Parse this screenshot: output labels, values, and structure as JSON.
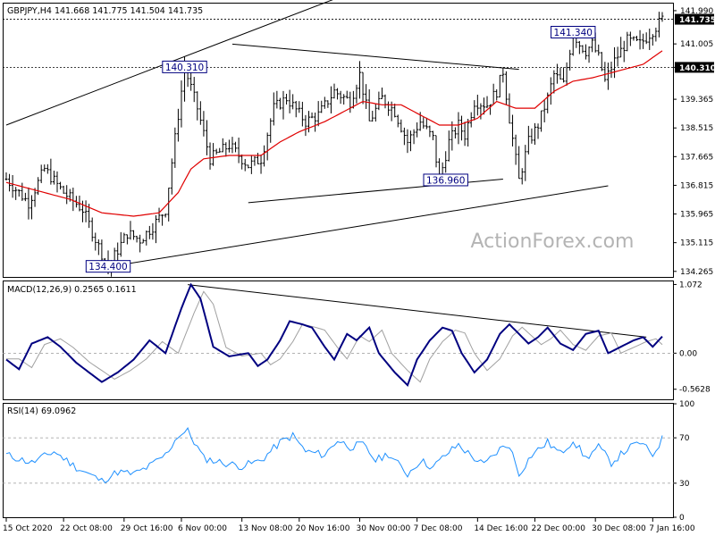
{
  "colors": {
    "bar": "#000000",
    "ma": "#e00000",
    "macd": "#000080",
    "signal": "#a0a0a0",
    "rsi": "#1e90ff",
    "watermark": "#b4b4b4",
    "label_box": "#000080",
    "price_tag": "#000000"
  },
  "chart_data": [
    {
      "type": "line",
      "panel": "price",
      "title": "GBPJPY,H4  141.668 141.775 141.504 141.735",
      "watermark": "ActionForex.com",
      "ylim": [
        134.1,
        142.2
      ],
      "y_ticks": [
        "141.990",
        "141.005",
        "140.310",
        "139.365",
        "138.515",
        "137.665",
        "136.815",
        "135.965",
        "135.115",
        "134.265"
      ],
      "y_tick_values": [
        141.99,
        141.005,
        140.31,
        139.365,
        138.515,
        137.665,
        136.815,
        135.965,
        135.115,
        134.265
      ],
      "current_price": "141.735",
      "current_price_value": 141.735,
      "level_price": "140.310",
      "level_price_value": 140.31,
      "annotations": [
        {
          "text": "140.310",
          "i": 56,
          "y": 140.31
        },
        {
          "text": "134.400",
          "i": 32,
          "y": 134.4
        },
        {
          "text": "136.960",
          "i": 138,
          "y": 136.96
        },
        {
          "text": "141.340",
          "i": 178,
          "y": 141.34
        }
      ],
      "lines": [
        {
          "name": "upper-channel-line",
          "i1": 0,
          "y1": 138.6,
          "i2": 109,
          "y2": 142.55
        },
        {
          "name": "lower-channel-line",
          "i1": 32,
          "y1": 134.4,
          "i2": 189,
          "y2": 136.8
        },
        {
          "name": "upper-triangle-line",
          "i1": 71,
          "y1": 141.0,
          "i2": 161,
          "y2": 140.25
        },
        {
          "name": "lower-triangle-line",
          "i1": 76,
          "y1": 136.3,
          "i2": 156,
          "y2": 137.0
        }
      ],
      "keypoints": [
        [
          0,
          137.0
        ],
        [
          7,
          136.3
        ],
        [
          12,
          137.3
        ],
        [
          18,
          136.6
        ],
        [
          24,
          136.1
        ],
        [
          29,
          135.0
        ],
        [
          32,
          134.4
        ],
        [
          38,
          135.4
        ],
        [
          42,
          135.2
        ],
        [
          46,
          135.6
        ],
        [
          50,
          136.1
        ],
        [
          54,
          138.9
        ],
        [
          56,
          140.31
        ],
        [
          60,
          139.1
        ],
        [
          64,
          137.6
        ],
        [
          70,
          138.0
        ],
        [
          76,
          137.4
        ],
        [
          80,
          137.6
        ],
        [
          84,
          139.1
        ],
        [
          88,
          139.4
        ],
        [
          94,
          138.7
        ],
        [
          98,
          138.9
        ],
        [
          103,
          139.6
        ],
        [
          108,
          139.3
        ],
        [
          111,
          140.1
        ],
        [
          114,
          138.7
        ],
        [
          118,
          139.4
        ],
        [
          122,
          139.0
        ],
        [
          126,
          138.1
        ],
        [
          130,
          138.7
        ],
        [
          134,
          138.2
        ],
        [
          136,
          136.96
        ],
        [
          139,
          138.1
        ],
        [
          142,
          138.6
        ],
        [
          144,
          138.3
        ],
        [
          147,
          139.3
        ],
        [
          151,
          139.2
        ],
        [
          154,
          139.6
        ],
        [
          156,
          140.2
        ],
        [
          158,
          138.8
        ],
        [
          161,
          136.96
        ],
        [
          164,
          138.1
        ],
        [
          167,
          138.6
        ],
        [
          170,
          139.4
        ],
        [
          172,
          140.1
        ],
        [
          175,
          139.8
        ],
        [
          178,
          141.34
        ],
        [
          180,
          141.0
        ],
        [
          182,
          140.8
        ],
        [
          184,
          141.0
        ],
        [
          186,
          140.6
        ],
        [
          188,
          139.9
        ],
        [
          191,
          140.5
        ],
        [
          195,
          141.1
        ],
        [
          199,
          141.0
        ],
        [
          203,
          141.4
        ],
        [
          206,
          141.735
        ]
      ],
      "ma_keypoints": [
        [
          0,
          136.9
        ],
        [
          12,
          136.6
        ],
        [
          20,
          136.4
        ],
        [
          30,
          136.0
        ],
        [
          40,
          135.9
        ],
        [
          48,
          136.0
        ],
        [
          54,
          136.6
        ],
        [
          58,
          137.3
        ],
        [
          62,
          137.6
        ],
        [
          70,
          137.7
        ],
        [
          80,
          137.7
        ],
        [
          86,
          138.1
        ],
        [
          92,
          138.4
        ],
        [
          100,
          138.7
        ],
        [
          106,
          139.0
        ],
        [
          112,
          139.3
        ],
        [
          118,
          139.2
        ],
        [
          124,
          139.2
        ],
        [
          130,
          138.9
        ],
        [
          136,
          138.6
        ],
        [
          142,
          138.6
        ],
        [
          148,
          138.8
        ],
        [
          154,
          139.3
        ],
        [
          160,
          139.1
        ],
        [
          166,
          139.1
        ],
        [
          172,
          139.6
        ],
        [
          178,
          139.9
        ],
        [
          184,
          140.0
        ],
        [
          192,
          140.2
        ],
        [
          200,
          140.4
        ],
        [
          206,
          140.8
        ]
      ],
      "n_bars": 207,
      "seed": 7
    },
    {
      "type": "line",
      "panel": "macd",
      "title": "MACD(12,26,9) 0.2565 0.1611",
      "ylim": [
        -0.72,
        1.12
      ],
      "y_ticks": [
        "1.072",
        "0.00",
        "-0.5628"
      ],
      "y_tick_values": [
        1.072,
        0.0,
        -0.5628
      ],
      "trendline": {
        "i1": 57,
        "y1": 1.07,
        "i2": 201,
        "y2": 0.25
      },
      "keypoints": [
        [
          0,
          -0.1
        ],
        [
          4,
          -0.25
        ],
        [
          8,
          0.15
        ],
        [
          13,
          0.25
        ],
        [
          17,
          0.1
        ],
        [
          22,
          -0.15
        ],
        [
          30,
          -0.45
        ],
        [
          35,
          -0.3
        ],
        [
          40,
          -0.1
        ],
        [
          45,
          0.2
        ],
        [
          50,
          0.0
        ],
        [
          55,
          0.7
        ],
        [
          58,
          1.07
        ],
        [
          61,
          0.85
        ],
        [
          65,
          0.1
        ],
        [
          70,
          -0.05
        ],
        [
          76,
          0.0
        ],
        [
          79,
          -0.2
        ],
        [
          82,
          -0.1
        ],
        [
          86,
          0.2
        ],
        [
          89,
          0.5
        ],
        [
          93,
          0.45
        ],
        [
          96,
          0.4
        ],
        [
          100,
          0.1
        ],
        [
          103,
          -0.1
        ],
        [
          107,
          0.3
        ],
        [
          110,
          0.2
        ],
        [
          114,
          0.4
        ],
        [
          117,
          0.0
        ],
        [
          122,
          -0.3
        ],
        [
          126,
          -0.5
        ],
        [
          129,
          -0.1
        ],
        [
          133,
          0.2
        ],
        [
          137,
          0.4
        ],
        [
          140,
          0.35
        ],
        [
          143,
          0.0
        ],
        [
          147,
          -0.3
        ],
        [
          151,
          -0.1
        ],
        [
          155,
          0.3
        ],
        [
          158,
          0.45
        ],
        [
          161,
          0.3
        ],
        [
          164,
          0.15
        ],
        [
          167,
          0.25
        ],
        [
          170,
          0.4
        ],
        [
          174,
          0.15
        ],
        [
          178,
          0.05
        ],
        [
          182,
          0.3
        ],
        [
          186,
          0.35
        ],
        [
          189,
          0.0
        ],
        [
          193,
          0.1
        ],
        [
          197,
          0.2
        ],
        [
          200,
          0.25
        ],
        [
          203,
          0.1
        ],
        [
          206,
          0.26
        ]
      ],
      "n_bars": 207,
      "signal_lag": 4
    },
    {
      "type": "line",
      "panel": "rsi",
      "title": "RSI(14) 69.0962",
      "ylim": [
        0,
        100
      ],
      "y_ticks": [
        "100",
        "70",
        "30",
        "0"
      ],
      "y_tick_values": [
        100,
        70,
        30,
        0
      ],
      "levels": [
        70,
        30
      ],
      "keypoints": [
        [
          0,
          55
        ],
        [
          8,
          48
        ],
        [
          15,
          58
        ],
        [
          22,
          44
        ],
        [
          30,
          32
        ],
        [
          35,
          40
        ],
        [
          40,
          38
        ],
        [
          45,
          45
        ],
        [
          50,
          55
        ],
        [
          54,
          72
        ],
        [
          57,
          76
        ],
        [
          62,
          52
        ],
        [
          68,
          48
        ],
        [
          74,
          45
        ],
        [
          80,
          50
        ],
        [
          86,
          66
        ],
        [
          90,
          72
        ],
        [
          94,
          58
        ],
        [
          100,
          55
        ],
        [
          104,
          68
        ],
        [
          108,
          62
        ],
        [
          112,
          64
        ],
        [
          116,
          50
        ],
        [
          120,
          56
        ],
        [
          126,
          38
        ],
        [
          130,
          50
        ],
        [
          134,
          44
        ],
        [
          138,
          55
        ],
        [
          142,
          64
        ],
        [
          146,
          54
        ],
        [
          150,
          46
        ],
        [
          155,
          60
        ],
        [
          158,
          64
        ],
        [
          161,
          38
        ],
        [
          165,
          55
        ],
        [
          170,
          66
        ],
        [
          174,
          56
        ],
        [
          178,
          68
        ],
        [
          182,
          52
        ],
        [
          186,
          62
        ],
        [
          190,
          48
        ],
        [
          195,
          60
        ],
        [
          199,
          66
        ],
        [
          203,
          55
        ],
        [
          206,
          69
        ]
      ],
      "n_bars": 207,
      "seed": 11
    }
  ],
  "x_axis": {
    "labels": [
      "15 Oct 2020",
      "22 Oct 08:00",
      "29 Oct 16:00",
      "6 Nov 00:00",
      "13 Nov 08:00",
      "20 Nov 16:00",
      "30 Nov 00:00",
      "7 Dec 08:00",
      "14 Dec 16:00",
      "22 Dec 00:00",
      "30 Dec 08:00",
      "7 Jan 16:00"
    ],
    "label_bars": [
      0,
      18,
      37,
      55,
      74,
      92,
      111,
      129,
      148,
      166,
      185,
      203
    ]
  }
}
